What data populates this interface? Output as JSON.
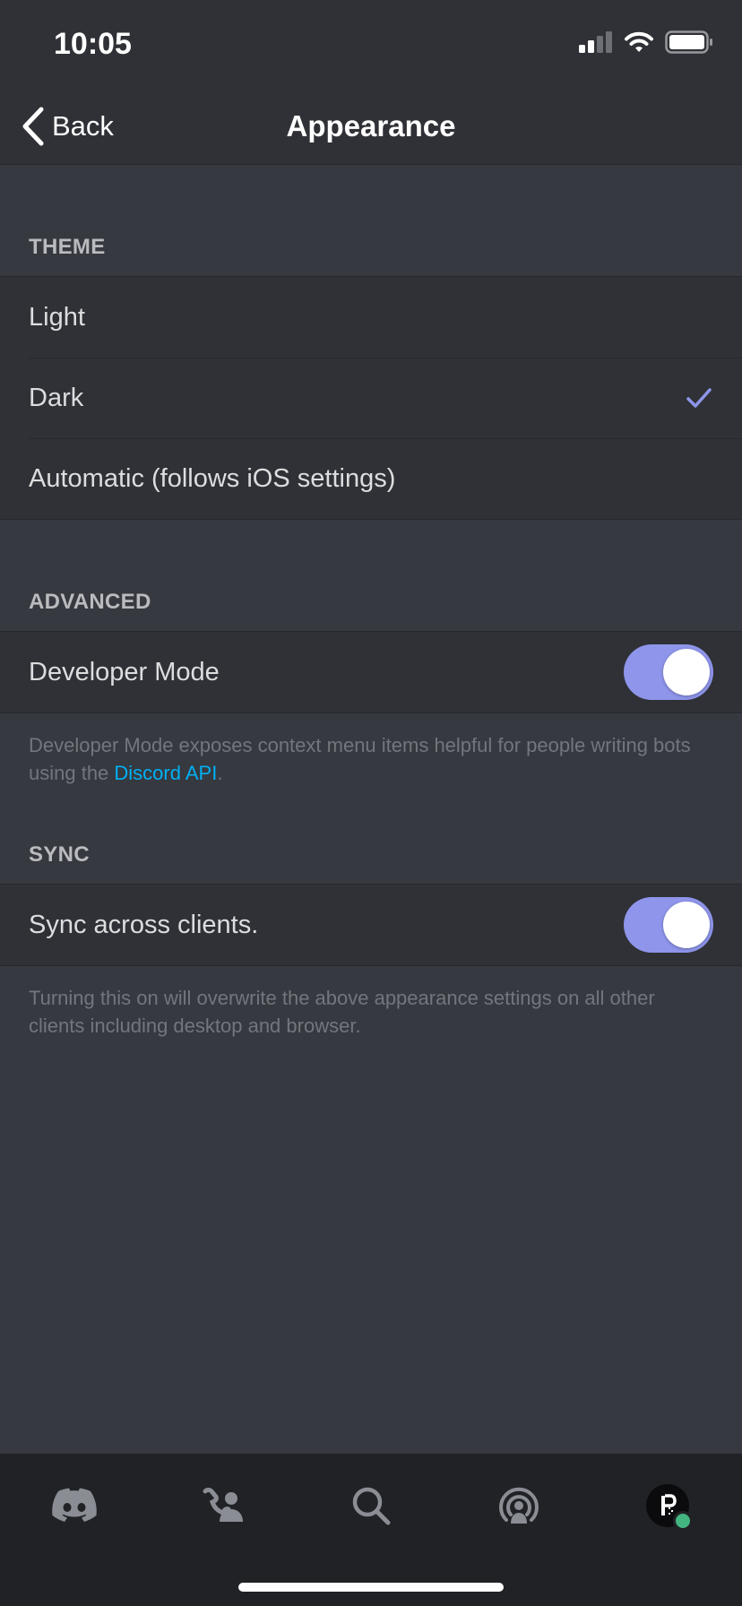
{
  "status_bar": {
    "time": "10:05"
  },
  "nav": {
    "back_label": "Back",
    "title": "Appearance"
  },
  "theme": {
    "header": "THEME",
    "options": [
      "Light",
      "Dark",
      "Automatic (follows iOS settings)"
    ],
    "selected": "Dark"
  },
  "advanced": {
    "header": "ADVANCED",
    "developer_mode_label": "Developer Mode",
    "developer_mode_on": true,
    "note_before_link": "Developer Mode exposes context menu items helpful for people writing bots using the ",
    "note_link": "Discord API",
    "note_after_link": "."
  },
  "sync": {
    "header": "SYNC",
    "sync_label": "Sync across clients.",
    "sync_on": true,
    "note": "Turning this on will overwrite the above appearance settings on all other clients including desktop and browser."
  },
  "tab_bar": {
    "tabs": [
      "discord-home-icon",
      "friends-icon",
      "search-icon",
      "mentions-icon",
      "profile-avatar"
    ]
  },
  "colors": {
    "accent": "#8e95ea",
    "link": "#00b0f4",
    "background": "#36393f",
    "surface": "#2f3136",
    "online": "#43b581"
  }
}
